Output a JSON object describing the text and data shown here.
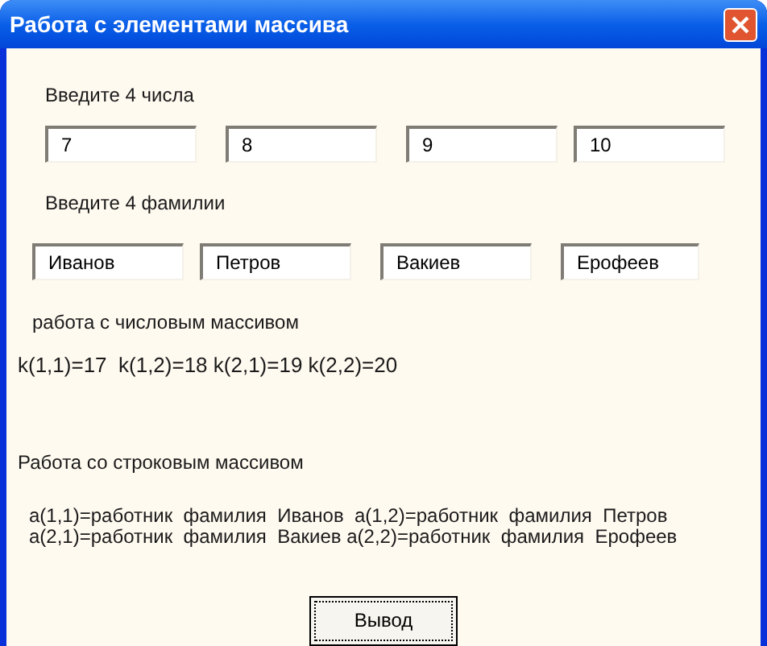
{
  "window": {
    "title": "Работа с элементами массива"
  },
  "numbers": {
    "label": "Введите 4 числа",
    "values": [
      "7",
      "8",
      "9",
      "10"
    ]
  },
  "surnames": {
    "label": "Введите 4 фамилии",
    "values": [
      "Иванов",
      "Петров",
      "Вакиев",
      "Ерофеев"
    ]
  },
  "numeric_section": {
    "label": "работа с числовым массивом",
    "result": "k(1,1)=17  k(1,2)=18 k(2,1)=19 k(2,2)=20"
  },
  "string_section": {
    "label": "Работа со строковым массивом",
    "result_lines": [
      "a(1,1)=работник  фамилия  Иванов  a(1,2)=работник  фамилия  Петров",
      "a(2,1)=работник  фамилия  Вакиев a(2,2)=работник  фамилия  Ерофеев"
    ]
  },
  "buttons": [
    "Вывод"
  ]
}
